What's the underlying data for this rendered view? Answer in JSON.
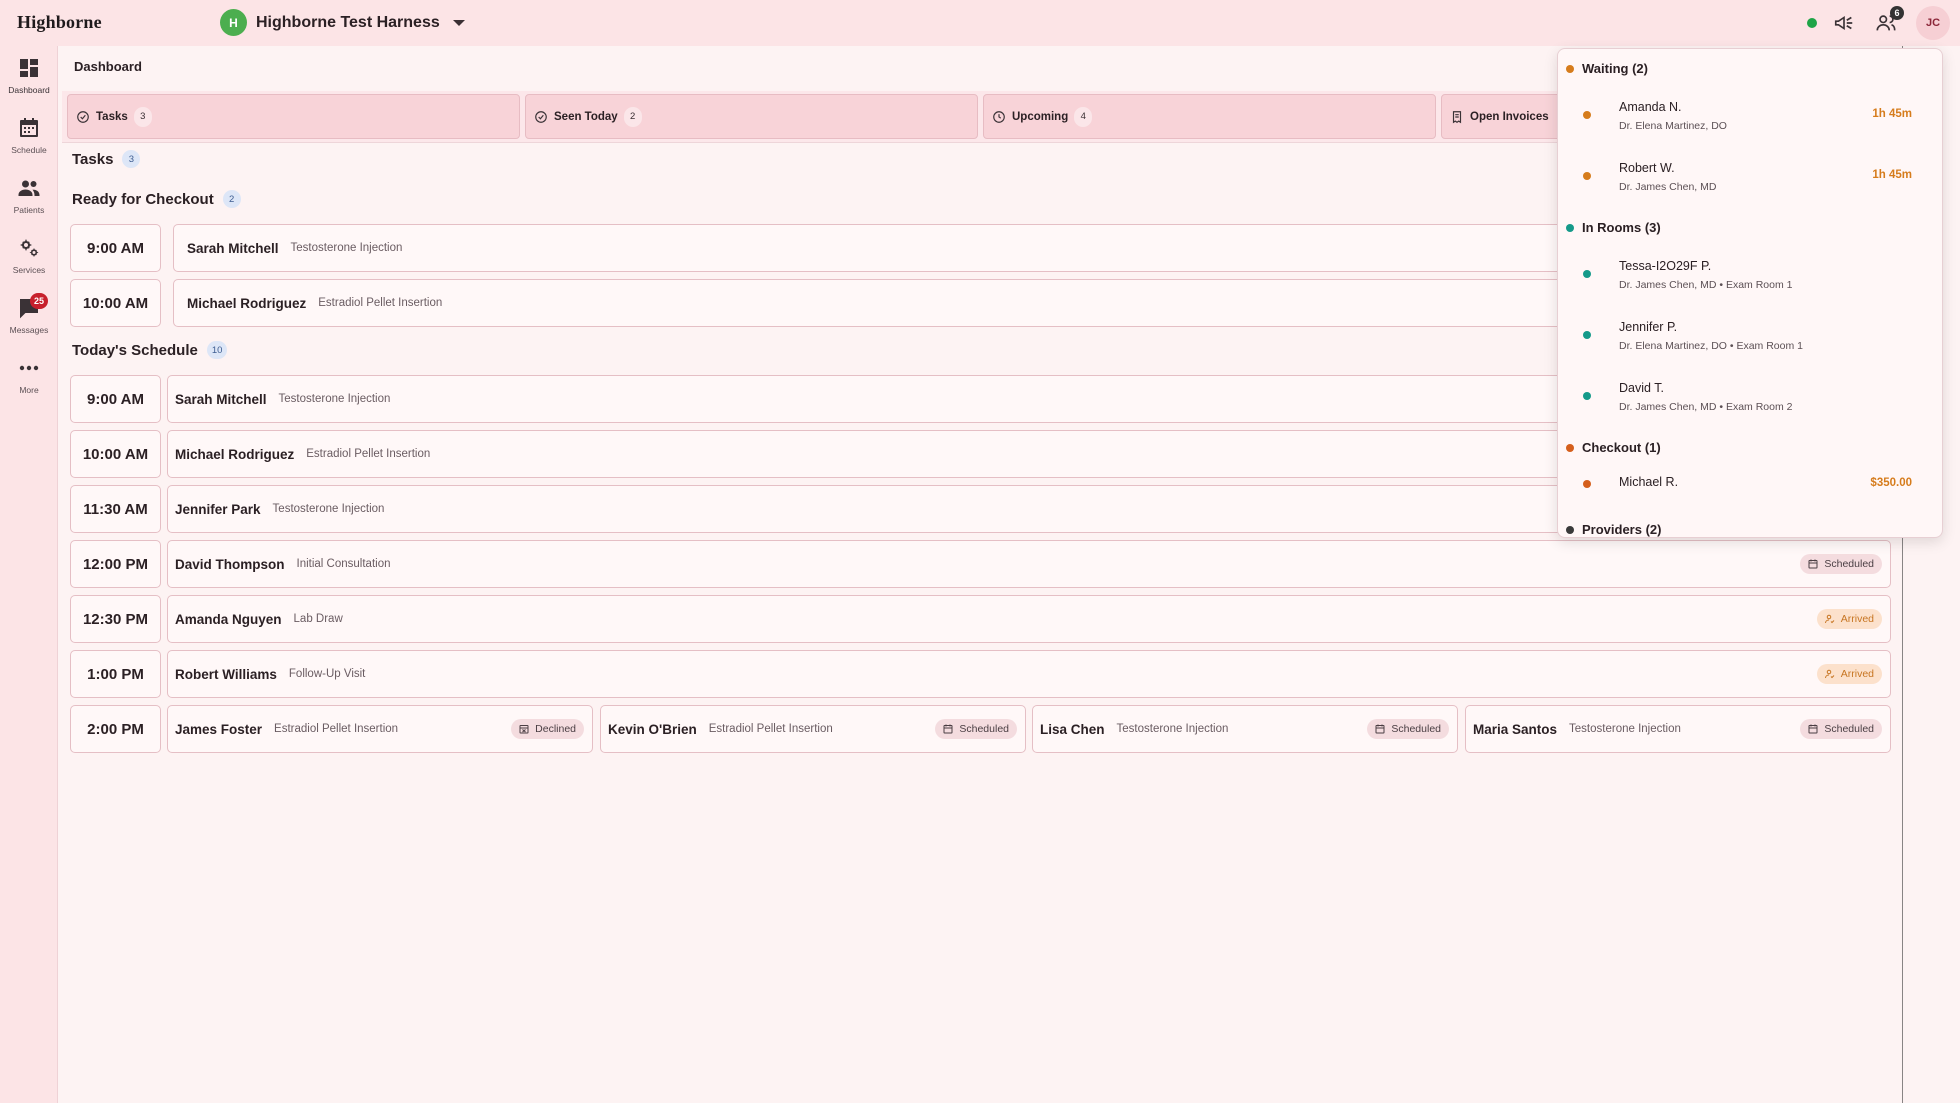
{
  "app": {
    "brand": "Highborne",
    "org_initial": "H",
    "org_name": "Highborne Test Harness",
    "notification_count": "6",
    "user_initials": "JC"
  },
  "sidebar": {
    "items": [
      {
        "label": "Dashboard",
        "icon": "dashboard-icon"
      },
      {
        "label": "Schedule",
        "icon": "calendar-icon"
      },
      {
        "label": "Patients",
        "icon": "people-icon"
      },
      {
        "label": "Services",
        "icon": "gears-icon"
      },
      {
        "label": "Messages",
        "icon": "chat-icon",
        "badge": "25"
      },
      {
        "label": "More",
        "icon": "more-icon"
      }
    ]
  },
  "page": {
    "title": "Dashboard"
  },
  "tabs": [
    {
      "label": "Tasks",
      "count": "3"
    },
    {
      "label": "Seen Today",
      "count": "2"
    },
    {
      "label": "Upcoming",
      "count": "4"
    },
    {
      "label": "Open Invoices",
      "count": ""
    }
  ],
  "tasks": {
    "title": "Tasks",
    "count": "3"
  },
  "checkout": {
    "title": "Ready for Checkout",
    "count": "2",
    "rows": [
      {
        "time": "9:00 AM",
        "name": "Sarah Mitchell",
        "service": "Testosterone Injection"
      },
      {
        "time": "10:00 AM",
        "name": "Michael Rodriguez",
        "service": "Estradiol Pellet Insertion"
      }
    ]
  },
  "schedule": {
    "title": "Today's Schedule",
    "count": "10",
    "rows": [
      {
        "time": "9:00 AM",
        "name": "Sarah Mitchell",
        "service": "Testosterone Injection"
      },
      {
        "time": "10:00 AM",
        "name": "Michael Rodriguez",
        "service": "Estradiol Pellet Insertion"
      },
      {
        "time": "11:30 AM",
        "name": "Jennifer Park",
        "service": "Testosterone Injection"
      },
      {
        "time": "12:00 PM",
        "name": "David Thompson",
        "service": "Initial Consultation",
        "status": "Scheduled"
      },
      {
        "time": "12:30 PM",
        "name": "Amanda Nguyen",
        "service": "Lab Draw",
        "status": "Arrived"
      },
      {
        "time": "1:00 PM",
        "name": "Robert Williams",
        "service": "Follow-Up Visit",
        "status": "Arrived"
      }
    ],
    "slot_2pm": {
      "time": "2:00 PM",
      "appts": [
        {
          "name": "James Foster",
          "service": "Estradiol Pellet Insertion",
          "status": "Declined"
        },
        {
          "name": "Kevin O'Brien",
          "service": "Estradiol Pellet Insertion",
          "status": "Scheduled"
        },
        {
          "name": "Lisa Chen",
          "service": "Testosterone Injection",
          "status": "Scheduled"
        },
        {
          "name": "Maria Santos",
          "service": "Testosterone Injection",
          "status": "Scheduled"
        }
      ]
    }
  },
  "popover": {
    "waiting": {
      "title": "Waiting (2)",
      "items": [
        {
          "name": "Amanda N.",
          "sub": "Dr. Elena Martinez, DO",
          "right": "1h 45m"
        },
        {
          "name": "Robert W.",
          "sub": "Dr. James Chen, MD",
          "right": "1h 45m"
        }
      ]
    },
    "in_rooms": {
      "title": "In Rooms (3)",
      "items": [
        {
          "name": "Tessa-I2O29F P.",
          "sub": "Dr. James Chen, MD • Exam Room 1"
        },
        {
          "name": "Jennifer P.",
          "sub": "Dr. Elena Martinez, DO • Exam Room 1"
        },
        {
          "name": "David T.",
          "sub": "Dr. James Chen, MD • Exam Room 2"
        }
      ]
    },
    "checkout": {
      "title": "Checkout (1)",
      "items": [
        {
          "name": "Michael R.",
          "right": "$350.00"
        }
      ]
    },
    "providers": {
      "title": "Providers (2)"
    }
  },
  "colors": {
    "waiting_dot": "#d67c1c",
    "in_rooms_dot": "#159a8a",
    "checkout_dot": "#d55f1c",
    "providers_dot": "#3a3a3a",
    "accent": "#c7202c"
  }
}
